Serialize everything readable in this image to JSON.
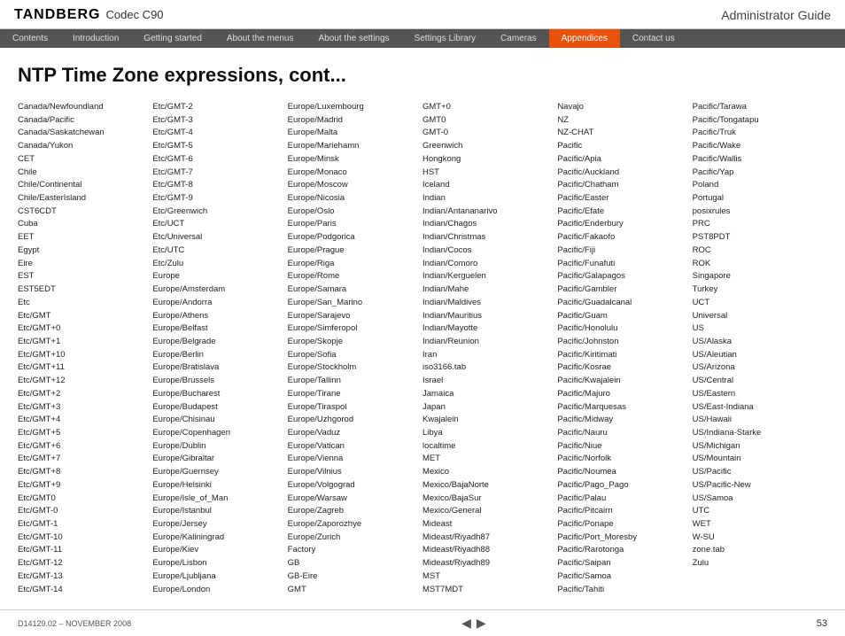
{
  "header": {
    "logo": "TANDBERG",
    "product": "Codec C90",
    "guide": "Administrator Guide"
  },
  "navbar": {
    "items": [
      {
        "label": "Contents",
        "active": false
      },
      {
        "label": "Introduction",
        "active": false
      },
      {
        "label": "Getting started",
        "active": false
      },
      {
        "label": "About the menus",
        "active": false
      },
      {
        "label": "About the settings",
        "active": false
      },
      {
        "label": "Settings Library",
        "active": false
      },
      {
        "label": "Cameras",
        "active": false
      },
      {
        "label": "Appendices",
        "active": true
      },
      {
        "label": "Contact us",
        "active": false
      }
    ]
  },
  "page": {
    "title": "NTP Time Zone expressions, cont...",
    "footer_doc": "D14129.02 – NOVEMBER 2008",
    "footer_page": "53"
  },
  "columns": [
    {
      "entries": [
        "Canada/Newfoundland",
        "Canada/Pacific",
        "Canada/Saskatchewan",
        "Canada/Yukon",
        "CET",
        "Chile",
        "Chile/Continental",
        "Chile/EasterIsland",
        "CST6CDT",
        "Cuba",
        "EET",
        "Egypt",
        "Eire",
        "EST",
        "EST5EDT",
        "Etc",
        "Etc/GMT",
        "Etc/GMT+0",
        "Etc/GMT+1",
        "Etc/GMT+10",
        "Etc/GMT+11",
        "Etc/GMT+12",
        "Etc/GMT+2",
        "Etc/GMT+3",
        "Etc/GMT+4",
        "Etc/GMT+5",
        "Etc/GMT+6",
        "Etc/GMT+7",
        "Etc/GMT+8",
        "Etc/GMT+9",
        "Etc/GMT0",
        "Etc/GMT-0",
        "Etc/GMT-1",
        "Etc/GMT-10",
        "Etc/GMT-11",
        "Etc/GMT-12",
        "Etc/GMT-13",
        "Etc/GMT-14"
      ]
    },
    {
      "entries": [
        "Etc/GMT-2",
        "Etc/GMT-3",
        "Etc/GMT-4",
        "Etc/GMT-5",
        "Etc/GMT-6",
        "Etc/GMT-7",
        "Etc/GMT-8",
        "Etc/GMT-9",
        "Etc/Greenwich",
        "Etc/UCT",
        "Etc/Universal",
        "Etc/UTC",
        "Etc/Zulu",
        "Europe",
        "Europe/Amsterdam",
        "Europe/Andorra",
        "Europe/Athens",
        "Europe/Belfast",
        "Europe/Belgrade",
        "Europe/Berlin",
        "Europe/Bratislava",
        "Europe/Brussels",
        "Europe/Bucharest",
        "Europe/Budapest",
        "Europe/Chisinau",
        "Europe/Copenhagen",
        "Europe/Dublin",
        "Europe/Gibraltar",
        "Europe/Guernsey",
        "Europe/Helsinki",
        "Europe/Isle_of_Man",
        "Europe/Istanbul",
        "Europe/Jersey",
        "Europe/Kaliningrad",
        "Europe/Kiev",
        "Europe/Lisbon",
        "Europe/Ljubljana",
        "Europe/London"
      ]
    },
    {
      "entries": [
        "Europe/Luxembourg",
        "Europe/Madrid",
        "Europe/Malta",
        "Europe/Mariehamn",
        "Europe/Minsk",
        "Europe/Monaco",
        "Europe/Moscow",
        "Europe/Nicosia",
        "Europe/Oslo",
        "Europe/Paris",
        "Europe/Podgorica",
        "Europe/Prague",
        "Europe/Riga",
        "Europe/Rome",
        "Europe/Samara",
        "Europe/San_Marino",
        "Europe/Sarajevo",
        "Europe/Simferopol",
        "Europe/Skopje",
        "Europe/Sofia",
        "Europe/Stockholm",
        "Europe/Tallinn",
        "Europe/Tirane",
        "Europe/Tiraspol",
        "Europe/Uzhgorod",
        "Europe/Vaduz",
        "Europe/Vatican",
        "Europe/Vienna",
        "Europe/Vilnius",
        "Europe/Volgograd",
        "Europe/Warsaw",
        "Europe/Zagreb",
        "Europe/Zaporozhye",
        "Europe/Zurich",
        "Factory",
        "GB",
        "GB-Eire",
        "GMT"
      ]
    },
    {
      "entries": [
        "GMT+0",
        "GMT0",
        "GMT-0",
        "Greenwich",
        "Hongkong",
        "HST",
        "Iceland",
        "Indian",
        "Indian/Antananarivo",
        "Indian/Chagos",
        "Indian/Christmas",
        "Indian/Cocos",
        "Indian/Comoro",
        "Indian/Kerguelen",
        "Indian/Mahe",
        "Indian/Maldives",
        "Indian/Mauritius",
        "Indian/Mayotte",
        "Indian/Reunion",
        "Iran",
        "iso3166.tab",
        "Israel",
        "Jamaica",
        "Japan",
        "Kwajalein",
        "Libya",
        "localtime",
        "MET",
        "Mexico",
        "Mexico/BajaNorte",
        "Mexico/BajaSur",
        "Mexico/General",
        "Mideast",
        "Mideast/Riyadh87",
        "Mideast/Riyadh88",
        "Mideast/Riyadh89",
        "MST",
        "MST7MDT"
      ]
    },
    {
      "entries": [
        "Navajo",
        "NZ",
        "NZ-CHAT",
        "Pacific",
        "Pacific/Apia",
        "Pacific/Auckland",
        "Pacific/Chatham",
        "Pacific/Easter",
        "Pacific/Efate",
        "Pacific/Enderbury",
        "Pacific/Fakaofo",
        "Pacific/Fiji",
        "Pacific/Funafuti",
        "Pacific/Galapagos",
        "Pacific/Gambler",
        "Pacific/Guadalcanal",
        "Pacific/Guam",
        "Pacific/Honolulu",
        "Pacific/Johnston",
        "Pacific/Kiritimati",
        "Pacific/Kosrae",
        "Pacific/Kwajalein",
        "Pacific/Majuro",
        "Pacific/Marquesas",
        "Pacific/Midway",
        "Pacific/Nauru",
        "Pacific/Niue",
        "Pacific/Norfolk",
        "Pacific/Noumea",
        "Pacific/Pago_Pago",
        "Pacific/Palau",
        "Pacific/Pitcairn",
        "Pacific/Ponape",
        "Pacific/Port_Moresby",
        "Pacific/Rarotonga",
        "Pacific/Saipan",
        "Pacific/Samoa",
        "Pacific/Tahiti"
      ]
    },
    {
      "entries": [
        "Pacific/Tarawa",
        "Pacific/Tongatapu",
        "Pacific/Truk",
        "Pacific/Wake",
        "Pacific/Wallis",
        "Pacific/Yap",
        "Poland",
        "Portugal",
        "posixrules",
        "PRC",
        "PST8PDT",
        "ROC",
        "ROK",
        "Singapore",
        "Turkey",
        "UCT",
        "Universal",
        "US",
        "US/Alaska",
        "US/Aleutian",
        "US/Arizona",
        "US/Central",
        "US/Eastern",
        "US/East-Indiana",
        "US/Hawaii",
        "US/Indiana-Starke",
        "US/Michigan",
        "US/Mountain",
        "US/Pacific",
        "US/Pacific-New",
        "US/Samoa",
        "UTC",
        "WET",
        "W-SU",
        "zone.tab",
        "Zulu"
      ]
    }
  ]
}
